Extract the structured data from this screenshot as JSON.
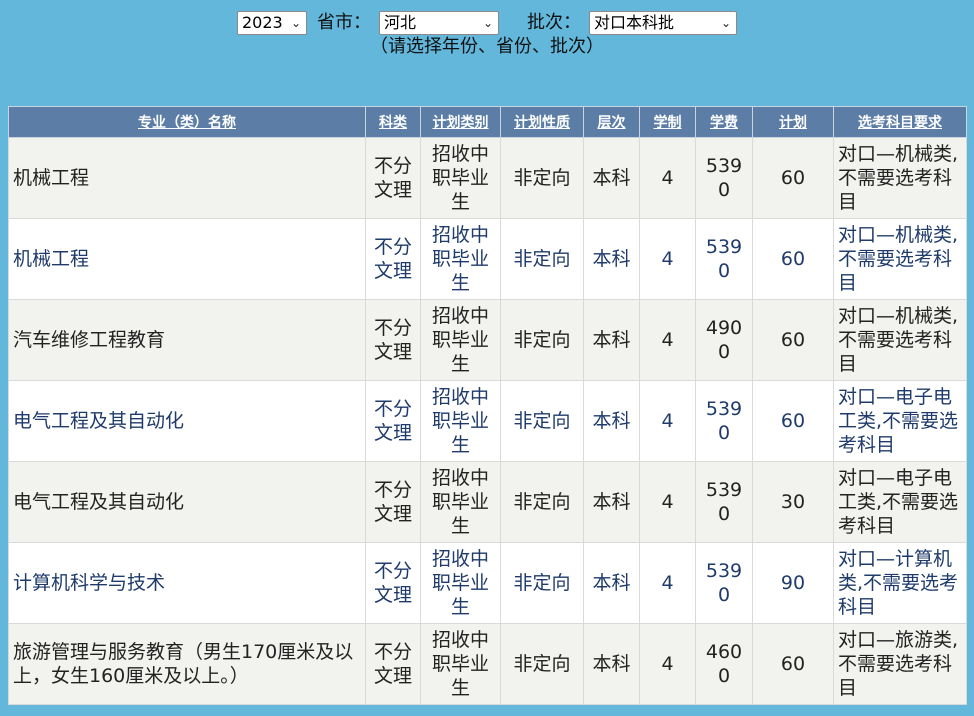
{
  "filters": {
    "year": "2023",
    "province_label": "省市：",
    "province": "河北",
    "batch_label": "批次：",
    "batch": "对口本科批",
    "hint": "（请选择年份、省份、批次）"
  },
  "table": {
    "headers": [
      "专业（类）名称",
      "科类",
      "计划类别",
      "计划性质",
      "层次",
      "学制",
      "学费",
      "计划",
      "选考科目要求"
    ],
    "rows": [
      [
        "机械工程",
        "不分文理",
        "招收中职毕业生",
        "非定向",
        "本科",
        "4",
        "5390",
        "60",
        "对口—机械类,不需要选考科目"
      ],
      [
        "机械工程",
        "不分文理",
        "招收中职毕业生",
        "非定向",
        "本科",
        "4",
        "5390",
        "60",
        "对口—机械类,不需要选考科目"
      ],
      [
        "汽车维修工程教育",
        "不分文理",
        "招收中职毕业生",
        "非定向",
        "本科",
        "4",
        "4900",
        "60",
        "对口—机械类,不需要选考科目"
      ],
      [
        "电气工程及其自动化",
        "不分文理",
        "招收中职毕业生",
        "非定向",
        "本科",
        "4",
        "5390",
        "60",
        "对口—电子电工类,不需要选考科目"
      ],
      [
        "电气工程及其自动化",
        "不分文理",
        "招收中职毕业生",
        "非定向",
        "本科",
        "4",
        "5390",
        "30",
        "对口—电子电工类,不需要选考科目"
      ],
      [
        "计算机科学与技术",
        "不分文理",
        "招收中职毕业生",
        "非定向",
        "本科",
        "4",
        "5390",
        "90",
        "对口—计算机类,不需要选考科目"
      ],
      [
        "旅游管理与服务教育（男生170厘米及以上，女生160厘米及以上。）",
        "不分文理",
        "招收中职毕业生",
        "非定向",
        "本科",
        "4",
        "4600",
        "60",
        "对口—旅游类,不需要选考科目"
      ]
    ]
  }
}
